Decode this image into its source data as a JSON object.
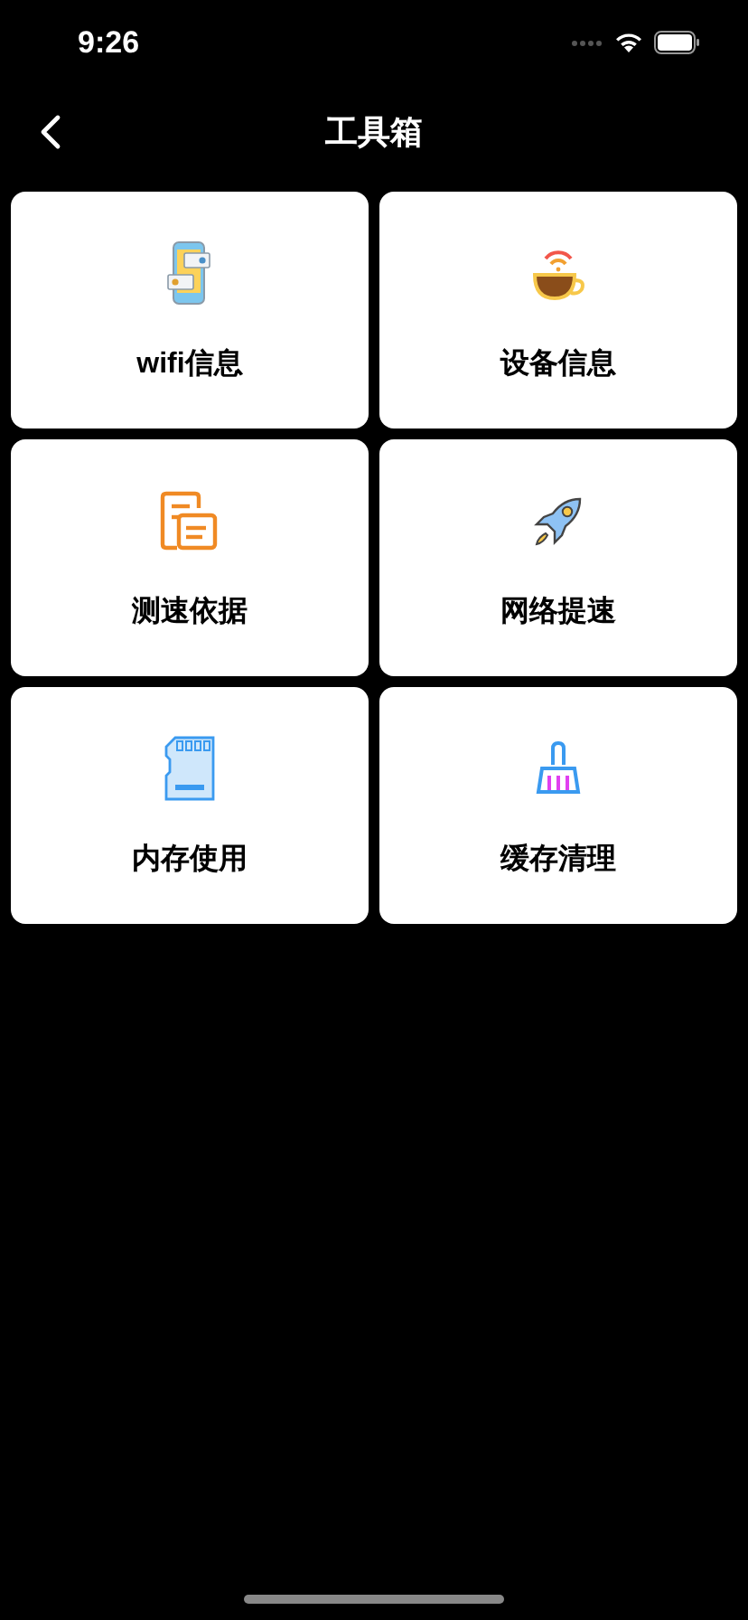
{
  "status_bar": {
    "time": "9:26"
  },
  "nav": {
    "title": "工具箱"
  },
  "tools": [
    {
      "kind": "phone",
      "label": "wifi信息"
    },
    {
      "kind": "cup",
      "label": "设备信息"
    },
    {
      "kind": "docs",
      "label": "测速依据"
    },
    {
      "kind": "rocket",
      "label": "网络提速"
    },
    {
      "kind": "card",
      "label": "内存使用"
    },
    {
      "kind": "broom",
      "label": "缓存清理"
    }
  ]
}
